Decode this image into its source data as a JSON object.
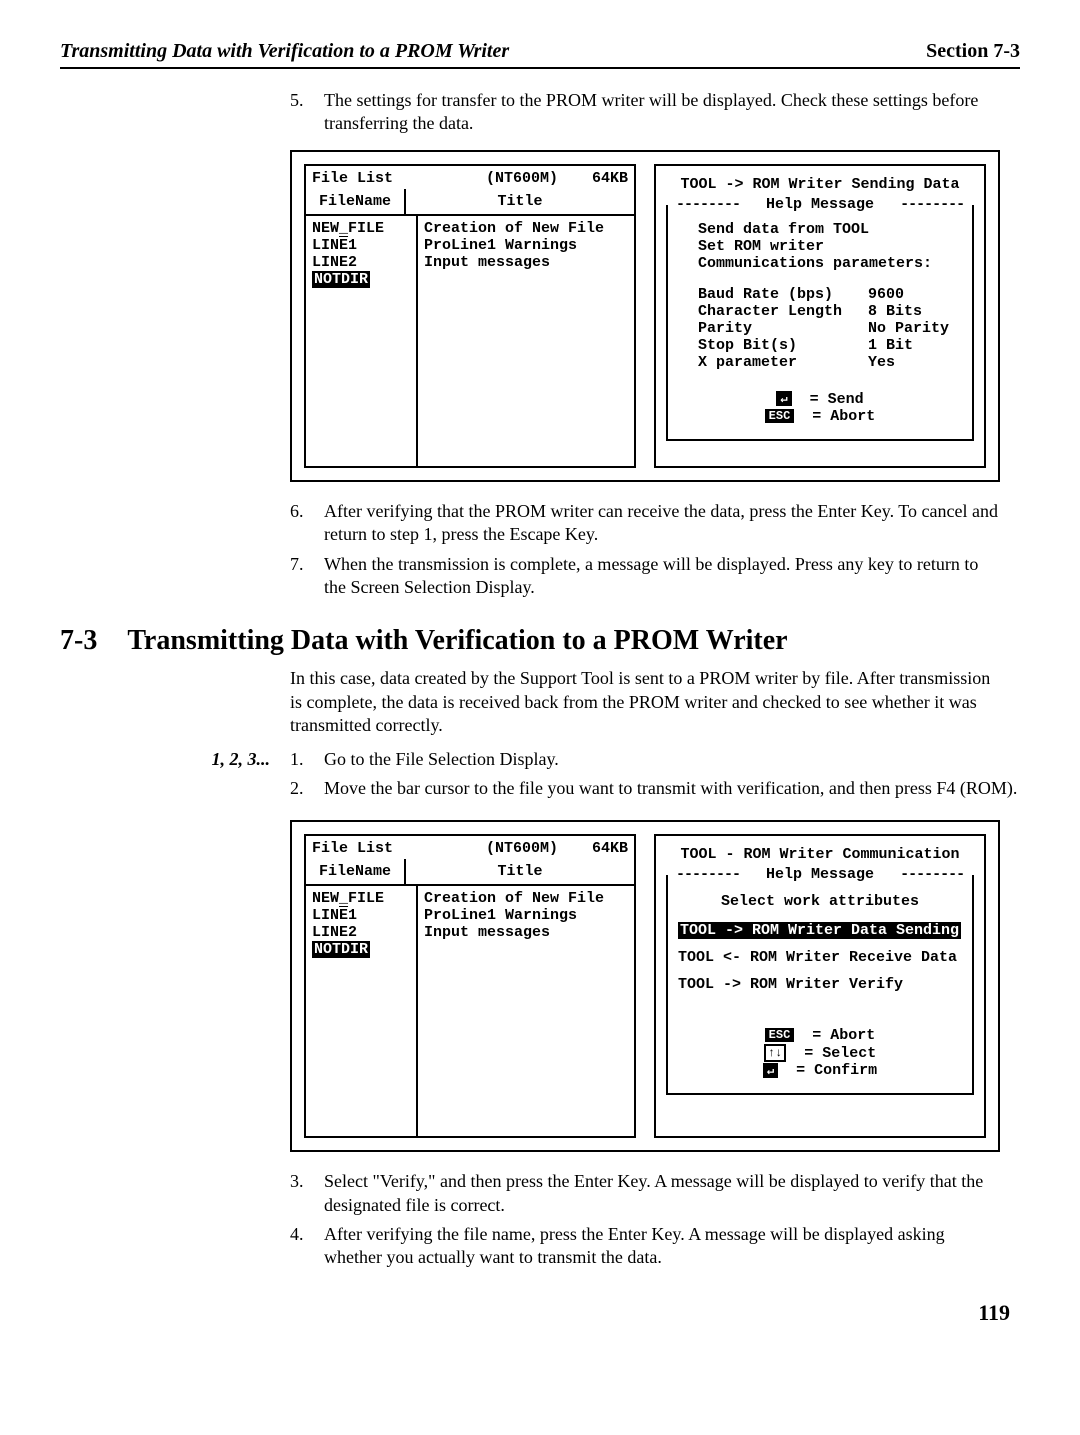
{
  "header": {
    "left": "Transmitting Data with Verification to a PROM Writer",
    "right": "Section 7-3"
  },
  "step5": {
    "n": "5.",
    "t": "The settings for transfer to the PROM writer will be displayed. Check these settings before transferring the data."
  },
  "fig1": {
    "filelist": "File List",
    "model": "(NT600M)",
    "size": "64KB",
    "fn_h": "FileName",
    "ti_h": "Title",
    "files": {
      "f1": "NEW_FILE",
      "f2": "LINE1",
      "f3": "LINE2",
      "f4": "NOTDIR"
    },
    "titles": {
      "t1": "Creation of New File",
      "t2": "ProLine1 Warnings",
      "t3": "Input messages"
    },
    "right_title": "TOOL -> ROM Writer Sending Data",
    "help_label": "Help Message",
    "msg1": "Send data from TOOL",
    "msg2": "Set ROM writer",
    "msg3": "Communications parameters:",
    "p1k": "Baud Rate (bps)",
    "p1v": "9600",
    "p2k": "Character Length",
    "p2v": "8 Bits",
    "p3k": "Parity",
    "p3v": "No Parity",
    "p4k": "Stop Bit(s)",
    "p4v": "1 Bit",
    "p5k": "X parameter",
    "p5v": "Yes",
    "k1cap": "↵",
    "k1": "=  Send",
    "k2cap": "ESC",
    "k2": "=  Abort"
  },
  "step6": {
    "n": "6.",
    "t": "After verifying that the PROM writer can receive the data, press the Enter Key. To cancel and return to step 1, press the Escape Key."
  },
  "step7": {
    "n": "7.",
    "t": "When the transmission is complete, a message will be displayed. Press any key to return to the Screen Selection Display."
  },
  "section": {
    "num": "7-3",
    "title": "Transmitting Data with Verification to a PROM Writer"
  },
  "intro": "In this case, data created by the Support Tool is sent to a PROM writer by file. After transmission is complete, the data is received back from the PROM writer and checked to see whether it was transmitted correctly.",
  "steps_label": "1, 2, 3...",
  "step1": {
    "n": "1.",
    "t": "Go to the File Selection Display."
  },
  "step2": {
    "n": "2.",
    "t": "Move the bar cursor to the file you want to transmit with verification, and then press F4 (ROM)."
  },
  "fig2": {
    "filelist": "File List",
    "model": "(NT600M)",
    "size": "64KB",
    "fn_h": "FileName",
    "ti_h": "Title",
    "files": {
      "f1": "NEW_FILE",
      "f2": "LINE1",
      "f3": "LINE2",
      "f4": "NOTDIR"
    },
    "titles": {
      "t1": "Creation of New File",
      "t2": "ProLine1 Warnings",
      "t3": "Input messages"
    },
    "right_title": "TOOL - ROM Writer Communication",
    "help_label": "Help Message",
    "sub": "Select work attributes",
    "m1": "TOOL -> ROM Writer Data Sending",
    "m2": "TOOL <- ROM Writer Receive Data",
    "m3": "TOOL -> ROM Writer Verify",
    "k1cap": "ESC",
    "k1": "=  Abort",
    "k2cap": "↑↓",
    "k2": "=  Select",
    "k3cap": "↵",
    "k3": "=  Confirm"
  },
  "step3": {
    "n": "3.",
    "t": "Select \"Verify,\" and then press the Enter Key. A message will be displayed to verify that the designated file is correct."
  },
  "step4": {
    "n": "4.",
    "t": "After verifying the file name, press the Enter Key. A message will be displayed asking whether you actually want to transmit the data."
  },
  "page_num": "119"
}
